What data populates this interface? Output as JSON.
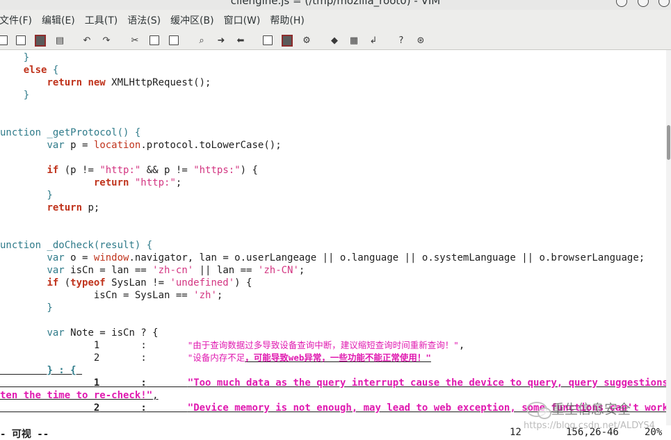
{
  "window": {
    "title": "cliengine.js = (/tmp/mozilla_root0) - VIM"
  },
  "menu": [
    "文件(F)",
    "编辑(E)",
    "工具(T)",
    "语法(S)",
    "缓冲区(B)",
    "窗口(W)",
    "帮助(H)"
  ],
  "toolbar_icons": [
    "open-icon",
    "save-session-icon",
    "save-icon",
    "print-icon",
    "undo-icon",
    "redo-icon",
    "cut-icon",
    "copy-icon",
    "paste-icon",
    "find-icon",
    "find-next-icon",
    "find-prev-icon",
    "load-session-icon",
    "save-session-file-icon",
    "run-script-icon",
    "make-icon",
    "tags-icon",
    "jump-tag-icon",
    "help-icon",
    "find-help-icon"
  ],
  "code": {
    "l1": "    }",
    "l2_kw": "else",
    "l2_rest": " {",
    "l3_kw1": "return",
    "l3_kw2": "new",
    "l3_rest": " XMLHttpRequest();",
    "l4": "    }",
    "l7": "unction _getProtocol() {",
    "l8_kw": "var",
    "l8_mid": " p = ",
    "l8_obj": "location",
    "l8_rest": ".protocol.toLowerCase();",
    "l10_kw": "if",
    "l10_a": " (p != ",
    "l10_s1": "\"http:\"",
    "l10_b": " && p != ",
    "l10_s2": "\"https:\"",
    "l10_c": ") {",
    "l11_kw": "return",
    "l11_s": "\"http:\"",
    "l11_rest": ";",
    "l12": "        }",
    "l13_kw": "return",
    "l13_rest": " p;",
    "l16": "unction _doCheck(result) {",
    "l17_kw": "var",
    "l17_mid": " o = ",
    "l17_obj": "window",
    "l17_rest": ".navigator, lan = o.userLangeage || o.language || o.systemLanguage || o.browserLanguage;",
    "l18_kw": "var",
    "l18_a": " isCn = lan == ",
    "l18_s1": "'zh-cn'",
    "l18_b": " || lan == ",
    "l18_s2": "'zh-CN'",
    "l18_c": ";",
    "l19_kw1": "if",
    "l19_kw2": "typeof",
    "l19_a": " SysLan != ",
    "l19_s": "'undefined'",
    "l19_b": ") {",
    "l20_a": "isCn = SysLan == ",
    "l20_s": "'zh'",
    "l20_b": ";",
    "l21": "        }",
    "l23_kw": "var",
    "l23_rest": " Note = isCn ? {",
    "l24_num": "1",
    "l24_colon": ":",
    "l24_str": "\"由于查询数据过多导致设备查询中断，建议缩短查询时间重新查询！\"",
    "l24_end": ",",
    "l25_num": "2",
    "l25_colon": ":",
    "l25_str1": "\"设备内存不足",
    "l25_str2": "，可能导致web异常，一些功能不能正常使用！\"",
    "l26": "} : {",
    "l27_num": "1",
    "l27_colon": ":",
    "l27_str": "\"Too much data as the query interrupt cause the device to query, query suggestions to sho",
    "l28_str": "ten the time to re-check!\"",
    "l28_end": ",",
    "l29_num": "2",
    "l29_colon": ":",
    "l29_str": "\"Device memory is not enough, may lead to web exception, some functions can't work properly!"
  },
  "status": {
    "mode": "- 可视 --",
    "count": "12",
    "position": "156,26-46",
    "percent": "20%"
  },
  "watermark": {
    "name": "重生信息安全",
    "url": "https://blog.csdn.net/ALDYS4"
  }
}
